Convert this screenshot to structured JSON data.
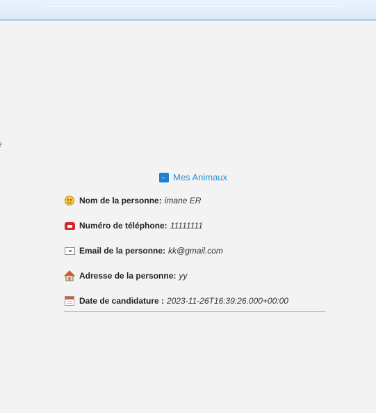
{
  "edge_text": "é",
  "back_link": {
    "label": "Mes Animaux",
    "icon": "back-arrow-icon",
    "color": "#2a8fd6"
  },
  "details": [
    {
      "icon": "smile-icon",
      "label": "Nom de la personne:",
      "value": "imane ER"
    },
    {
      "icon": "telephone-icon",
      "label": "Numéro de téléphone:",
      "value": "11111111"
    },
    {
      "icon": "envelope-icon",
      "label": "Email de la personne:",
      "value": "kk@gmail.com"
    },
    {
      "icon": "house-icon",
      "label": "Adresse de la personne:",
      "value": "yy"
    },
    {
      "icon": "calendar-icon",
      "label": "Date de candidature :",
      "value": "2023-11-26T16:39:26.000+00:00"
    }
  ]
}
